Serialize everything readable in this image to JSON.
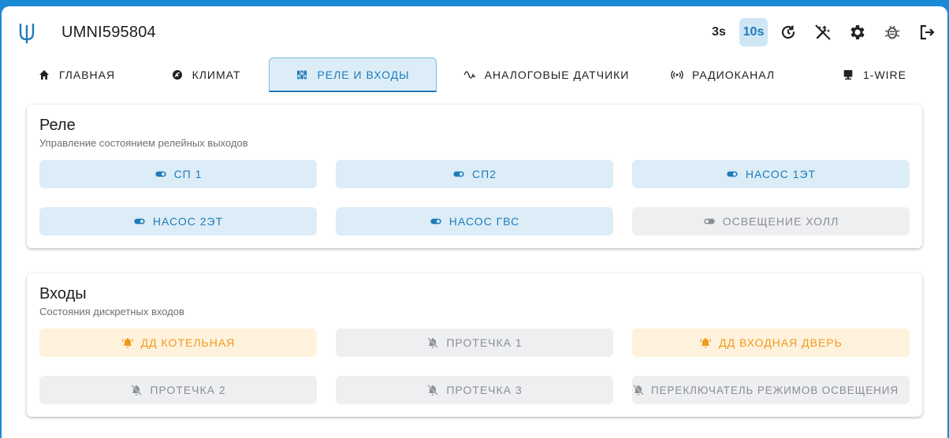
{
  "header": {
    "device_name": "UMNI595804",
    "interval_3s": "3s",
    "interval_10s": "10s"
  },
  "tabs": [
    {
      "label": "ГЛАВНАЯ",
      "icon": "home-icon"
    },
    {
      "label": "КЛИМАТ",
      "icon": "climate-icon"
    },
    {
      "label": "РЕЛЕ И ВХОДЫ",
      "icon": "relay-icon",
      "active": true
    },
    {
      "label": "АНАЛОГОВЫЕ ДАТЧИКИ",
      "icon": "sine-wave-icon"
    },
    {
      "label": "РАДИОКАНАЛ",
      "icon": "radio-icon"
    },
    {
      "label": "1-WIRE",
      "icon": "one-wire-icon"
    }
  ],
  "relays": {
    "title": "Реле",
    "subtitle": "Управление состоянием релейных выходов",
    "items": [
      {
        "label": "СП 1",
        "state": "on"
      },
      {
        "label": "СП2",
        "state": "on"
      },
      {
        "label": "НАСОС 1ЭТ",
        "state": "on"
      },
      {
        "label": "НАСОС 2ЭТ",
        "state": "on"
      },
      {
        "label": "НАСОС ГВС",
        "state": "on"
      },
      {
        "label": "ОСВЕЩЕНИЕ ХОЛЛ",
        "state": "off"
      }
    ]
  },
  "inputs": {
    "title": "Входы",
    "subtitle": "Состояния дискретных входов",
    "items": [
      {
        "label": "ДД КОТЕЛЬНАЯ",
        "state": "alarm"
      },
      {
        "label": "ПРОТЕЧКА 1",
        "state": "off"
      },
      {
        "label": "ДД ВХОДНАЯ ДВЕРЬ",
        "state": "alarm"
      },
      {
        "label": "ПРОТЕЧКА 2",
        "state": "off"
      },
      {
        "label": "ПРОТЕЧКА 3",
        "state": "off"
      },
      {
        "label": "ПЕРЕКЛЮЧАТЕЛЬ РЕЖИМОВ ОСВЕЩЕНИЯ",
        "state": "off"
      }
    ]
  },
  "colors": {
    "frame": "#1a8ad6",
    "accent": "#1f7bb8",
    "on_bg": "#dcedf8",
    "off_bg": "#eeeff1",
    "alarm_bg": "#fff2dd",
    "alarm_fg": "#ef9a1a"
  }
}
